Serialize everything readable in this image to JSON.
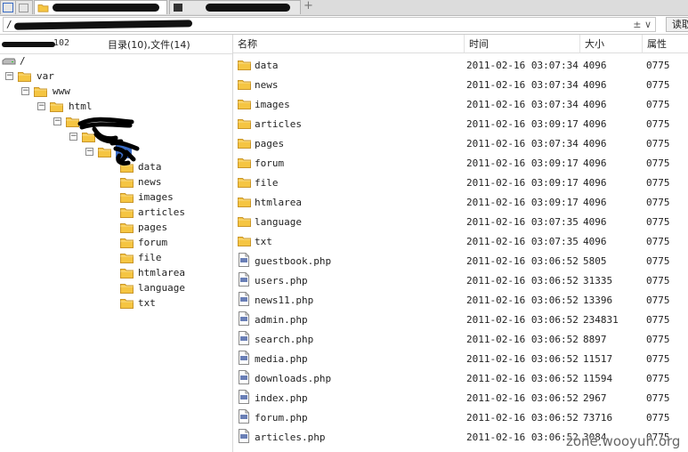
{
  "tabs": [
    {
      "label": "",
      "active": false
    },
    {
      "label": "",
      "active": true
    },
    {
      "label": "",
      "active": false
    }
  ],
  "new_tab_label": "+",
  "path": {
    "value": "/",
    "dropdown": "± ∨"
  },
  "read_button": "读取",
  "left_header": {
    "host_tail": "102",
    "counts": "目录(10),文件(14)"
  },
  "columns": {
    "name": "名称",
    "time": "时间",
    "size": "大小",
    "perm": "属性"
  },
  "tree": {
    "root": "/",
    "nodes": [
      {
        "label": "var",
        "toggle": "−"
      },
      {
        "label": "www",
        "toggle": "−"
      },
      {
        "label": "html",
        "toggle": "−"
      },
      {
        "label": "",
        "toggle": "−"
      },
      {
        "label": "",
        "toggle": "−"
      },
      {
        "label": "",
        "toggle": "−"
      }
    ],
    "children": [
      "data",
      "news",
      "images",
      "articles",
      "pages",
      "forum",
      "file",
      "htmlarea",
      "language",
      "txt"
    ]
  },
  "files": [
    {
      "name": "data",
      "time": "2011-02-16 03:07:34",
      "size": "4096",
      "perm": "0775",
      "kind": "folder"
    },
    {
      "name": "news",
      "time": "2011-02-16 03:07:34",
      "size": "4096",
      "perm": "0775",
      "kind": "folder"
    },
    {
      "name": "images",
      "time": "2011-02-16 03:07:34",
      "size": "4096",
      "perm": "0775",
      "kind": "folder"
    },
    {
      "name": "articles",
      "time": "2011-02-16 03:09:17",
      "size": "4096",
      "perm": "0775",
      "kind": "folder"
    },
    {
      "name": "pages",
      "time": "2011-02-16 03:07:34",
      "size": "4096",
      "perm": "0775",
      "kind": "folder"
    },
    {
      "name": "forum",
      "time": "2011-02-16 03:09:17",
      "size": "4096",
      "perm": "0775",
      "kind": "folder"
    },
    {
      "name": "file",
      "time": "2011-02-16 03:09:17",
      "size": "4096",
      "perm": "0775",
      "kind": "folder"
    },
    {
      "name": "htmlarea",
      "time": "2011-02-16 03:09:17",
      "size": "4096",
      "perm": "0775",
      "kind": "folder"
    },
    {
      "name": "language",
      "time": "2011-02-16 03:07:35",
      "size": "4096",
      "perm": "0775",
      "kind": "folder"
    },
    {
      "name": "txt",
      "time": "2011-02-16 03:07:35",
      "size": "4096",
      "perm": "0775",
      "kind": "folder"
    },
    {
      "name": "guestbook.php",
      "time": "2011-02-16 03:06:52",
      "size": "5805",
      "perm": "0775",
      "kind": "php"
    },
    {
      "name": "users.php",
      "time": "2011-02-16 03:06:52",
      "size": "31335",
      "perm": "0775",
      "kind": "php"
    },
    {
      "name": "news11.php",
      "time": "2011-02-16 03:06:52",
      "size": "13396",
      "perm": "0775",
      "kind": "php"
    },
    {
      "name": "admin.php",
      "time": "2011-02-16 03:06:52",
      "size": "234831",
      "perm": "0775",
      "kind": "php"
    },
    {
      "name": "search.php",
      "time": "2011-02-16 03:06:52",
      "size": "8897",
      "perm": "0775",
      "kind": "php"
    },
    {
      "name": "media.php",
      "time": "2011-02-16 03:06:52",
      "size": "11517",
      "perm": "0775",
      "kind": "php"
    },
    {
      "name": "downloads.php",
      "time": "2011-02-16 03:06:52",
      "size": "11594",
      "perm": "0775",
      "kind": "php"
    },
    {
      "name": "index.php",
      "time": "2011-02-16 03:06:52",
      "size": "2967",
      "perm": "0775",
      "kind": "php"
    },
    {
      "name": "forum.php",
      "time": "2011-02-16 03:06:52",
      "size": "73716",
      "perm": "0775",
      "kind": "php"
    },
    {
      "name": "articles.php",
      "time": "2011-02-16 03:06:52",
      "size": "3084",
      "perm": "0775",
      "kind": "php"
    }
  ],
  "watermark": "zone.wooyun.org",
  "colors": {
    "folder": "#f5c542",
    "folder_edge": "#c9962a",
    "selection": "#3a6bc4",
    "redaction": "#111111"
  },
  "icons": {
    "folder": "folder-icon",
    "php": "php-file-icon",
    "drive": "drive-icon"
  }
}
